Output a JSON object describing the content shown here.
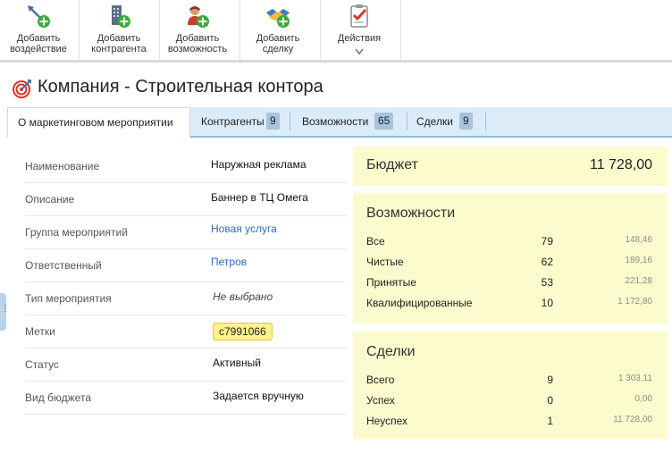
{
  "toolbar": {
    "add_action": "Добавить воздействие",
    "add_contractor": "Добавить контрагента",
    "add_opportunity": "Добавить возможность",
    "add_deal": "Добавить сделку",
    "actions": "Действия"
  },
  "header": {
    "title": "Компания - Строительная контора"
  },
  "tabs": [
    {
      "label": "О маркетинговом мероприятии",
      "count": ""
    },
    {
      "label": "Контрагенты",
      "count": "9"
    },
    {
      "label": "Возможности",
      "count": "65"
    },
    {
      "label": "Сделки",
      "count": "9"
    }
  ],
  "fields": [
    {
      "label": "Наименование",
      "value": "Наружная реклама"
    },
    {
      "label": "Описание",
      "value": "Баннер в ТЦ Омега"
    },
    {
      "label": "Группа мероприятий",
      "value": "Новая услуга"
    },
    {
      "label": "Ответственный",
      "value": "Петров"
    },
    {
      "label": "Тип мероприятия",
      "value": "Не выбрано"
    },
    {
      "label": "Метки",
      "value": "c7991066"
    },
    {
      "label": "Статус",
      "value": "Активный"
    },
    {
      "label": "Вид бюджета",
      "value": "Задается вручную"
    }
  ],
  "budget": {
    "label": "Бюджет",
    "value": "11 728,00"
  },
  "opportunities": {
    "title": "Возможности",
    "rows": [
      {
        "name": "Все",
        "count": "79",
        "amount": "148,46"
      },
      {
        "name": "Чистые",
        "count": "62",
        "amount": "189,16"
      },
      {
        "name": "Принятые",
        "count": "53",
        "amount": "221,28"
      },
      {
        "name": "Квалифицированные",
        "count": "10",
        "amount": "1 172,80"
      }
    ]
  },
  "deals": {
    "title": "Сделки",
    "rows": [
      {
        "name": "Всего",
        "count": "9",
        "amount": "1 303,11"
      },
      {
        "name": "Успех",
        "count": "0",
        "amount": "0,00"
      },
      {
        "name": "Неуспех",
        "count": "1",
        "amount": "11 728,00"
      }
    ]
  },
  "colors": {
    "tab_bar": "#dcebf8",
    "panel_bg": "#fbfbcd",
    "link": "#2f6bb8",
    "tag_bg": "#fdf28a"
  },
  "icons": [
    "target-arrow-add-icon",
    "building-add-icon",
    "person-add-icon",
    "handshake-add-icon",
    "checklist-icon",
    "chevron-down-icon",
    "target-icon"
  ]
}
